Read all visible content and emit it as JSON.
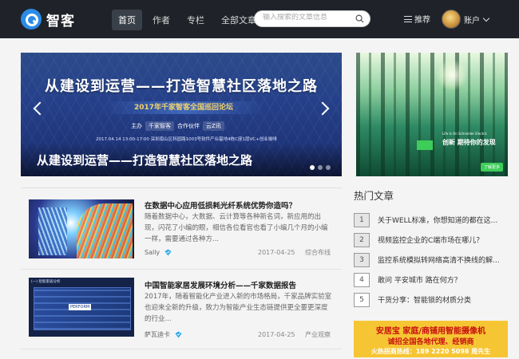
{
  "site": {
    "name": "智客"
  },
  "nav": {
    "items": [
      "首页",
      "作者",
      "专栏",
      "全部文章"
    ]
  },
  "search": {
    "placeholder": "输入搜索的文章信息"
  },
  "header": {
    "recommend_label": "推荐",
    "account_label": "账户"
  },
  "carousel": {
    "headline": "从建设到运营——打造智慧社区落地之路",
    "subtitle": "2017年千家智客全国巡回论坛",
    "host_label": "主办",
    "partner_label": "合作伙伴",
    "partner_name": "云Z讯",
    "date_line": "2017.04.14 13:00-17:00  深圳南山区科园路1003号软件产业基地4栋C座1层VC+创业咖啡",
    "caption": "从建设到运营——打造智慧社区落地之路",
    "slide_count": 3,
    "active_slide": 1
  },
  "articles": [
    {
      "title": "在数据中心应用低损耗光纤系统优势你造吗？",
      "summary": "随着数据中心，大数据、云计算等各种新名词，新应用的出现，闪花了小编的眼，相信各位看官也看了小编几个月的小编一样，需要通过各种方...",
      "author": "Sally",
      "date": "2017-04-25",
      "tag": "综合布线"
    },
    {
      "title": "中国智能家居发展环境分析——千家数据报告",
      "summary": "2017年，随着智能化产业进入新的市场格局，千家品牌实验室也迎来全新的升级，致力为智能产业生态链提供更全要更深度的行业...",
      "author": "萨瓦迪卡",
      "date": "2017-04-25",
      "tag": "产业观察",
      "thumb_label": "(一) 智能家居分析"
    }
  ],
  "sidebar": {
    "ad_top": {
      "brand": "Life Is On  Schneider Electric",
      "slogan": "创新 期待你的发现",
      "more": "了解更多"
    },
    "hot_title": "热门文章",
    "hot_articles": [
      {
        "rank": "1",
        "text": "关于WELL标准，你想知道的都在这..."
      },
      {
        "rank": "2",
        "text": "视频监控企业的C端市场在哪儿？"
      },
      {
        "rank": "3",
        "text": "监控系统模拟转网络高清不换线的解..."
      },
      {
        "rank": "4",
        "text": "敢问 平安城市 路在何方？"
      },
      {
        "rank": "5",
        "text": "干货分享：智能锁的材质分类"
      }
    ],
    "ad_bottom": {
      "line1": "安居宝  家庭/商铺用智能摄像机",
      "line2": "诚招全国各地代理、经销商",
      "line3": "火热招商热线：189 2220 5098  周先生"
    }
  },
  "colors": {
    "header_bg": "#1f2329",
    "accent": "#2a8be8",
    "verify": "#2aa8e8"
  }
}
